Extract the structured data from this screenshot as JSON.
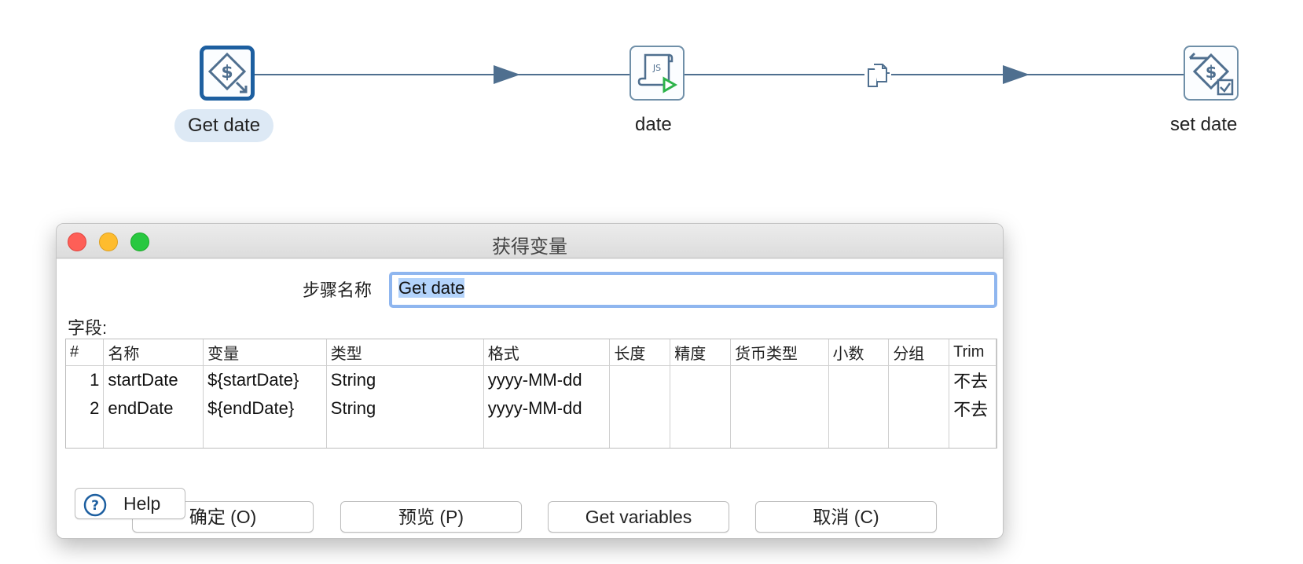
{
  "canvas": {
    "steps": [
      {
        "label": "Get date",
        "icon": "get-variables-icon",
        "selected": true
      },
      {
        "label": "date",
        "icon": "javascript-script-icon",
        "selected": false
      },
      {
        "label": "set date",
        "icon": "set-variables-icon",
        "selected": false
      }
    ],
    "hop_color": "#4f6f8f",
    "selected_color": "#1d5fa0"
  },
  "dialog": {
    "title": "获得变量",
    "step_name_label": "步骤名称",
    "step_name_value": "Get date",
    "fields_label": "字段:",
    "table": {
      "columns": [
        "#",
        "名称",
        "变量",
        "类型",
        "格式",
        "长度",
        "精度",
        "货币类型",
        "小数",
        "分组",
        "Trim"
      ],
      "rows": [
        [
          "1",
          "startDate",
          "${startDate}",
          "String",
          "yyyy-MM-dd",
          "",
          "",
          "",
          "",
          "",
          "不去"
        ],
        [
          "2",
          "endDate",
          "${endDate}",
          "String",
          "yyyy-MM-dd",
          "",
          "",
          "",
          "",
          "",
          "不去"
        ]
      ]
    },
    "buttons": {
      "ok": "确定 (O)",
      "preview": "预览 (P)",
      "get_variables": "Get variables",
      "cancel": "取消 (C)",
      "help": "Help"
    }
  }
}
